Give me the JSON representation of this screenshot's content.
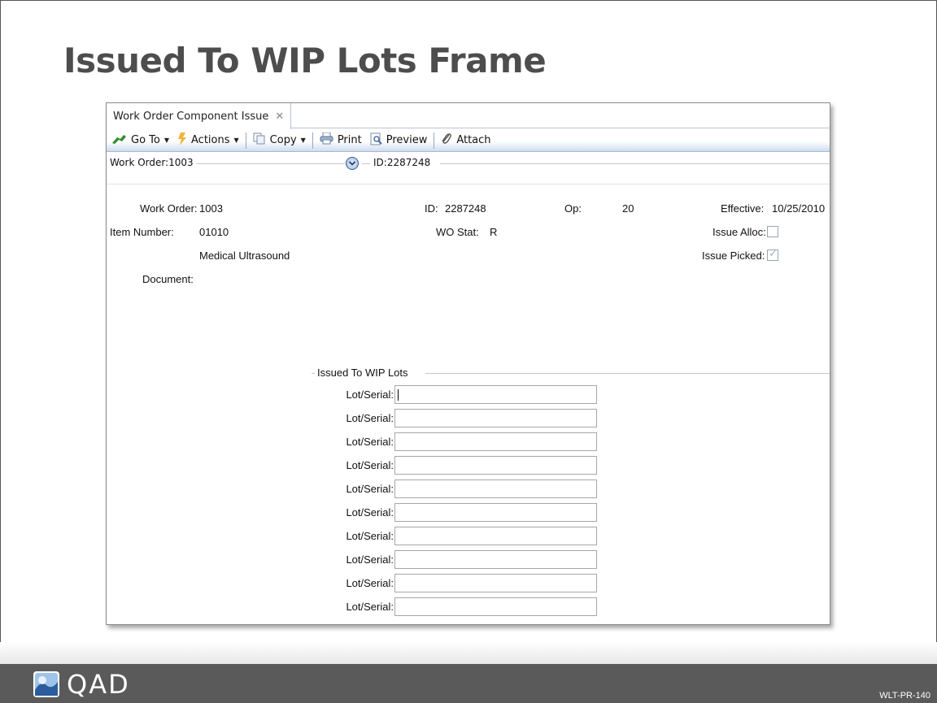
{
  "slide": {
    "title": "Issued To WIP Lots Frame",
    "logo_text": "QAD",
    "code": "WLT-PR-140"
  },
  "window": {
    "tab_label": "Work Order Component Issue",
    "toolbar": {
      "goto": "Go To",
      "actions": "Actions",
      "copy": "Copy",
      "print": "Print",
      "preview": "Preview",
      "attach": "Attach"
    },
    "crumb": {
      "left": "Work Order:1003",
      "right": "ID:2287248"
    }
  },
  "form": {
    "work_order_label": "Work Order:",
    "work_order_value": "1003",
    "id_label": "ID:",
    "id_value": "2287248",
    "op_label": "Op:",
    "op_value": "20",
    "effective_label": "Effective:",
    "effective_value": "10/25/2010",
    "item_number_label": "Item Number:",
    "item_number_value": "01010",
    "wo_stat_label": "WO Stat:",
    "wo_stat_value": "R",
    "issue_alloc_label": "Issue Alloc:",
    "issue_alloc_checked": false,
    "description": "Medical Ultrasound",
    "issue_picked_label": "Issue Picked:",
    "issue_picked_checked": true,
    "document_label": "Document:"
  },
  "wip_frame": {
    "title": "Issued To WIP Lots",
    "rows": [
      {
        "label": "Lot/Serial:",
        "value": ""
      },
      {
        "label": "Lot/Serial:",
        "value": ""
      },
      {
        "label": "Lot/Serial:",
        "value": ""
      },
      {
        "label": "Lot/Serial:",
        "value": ""
      },
      {
        "label": "Lot/Serial:",
        "value": ""
      },
      {
        "label": "Lot/Serial:",
        "value": ""
      },
      {
        "label": "Lot/Serial:",
        "value": ""
      },
      {
        "label": "Lot/Serial:",
        "value": ""
      },
      {
        "label": "Lot/Serial:",
        "value": ""
      },
      {
        "label": "Lot/Serial:",
        "value": ""
      }
    ]
  },
  "colors": {
    "title": "#4d4d4d",
    "footer": "#5a5a5a",
    "toolbar_gradient_end": "#cfdcf0"
  }
}
